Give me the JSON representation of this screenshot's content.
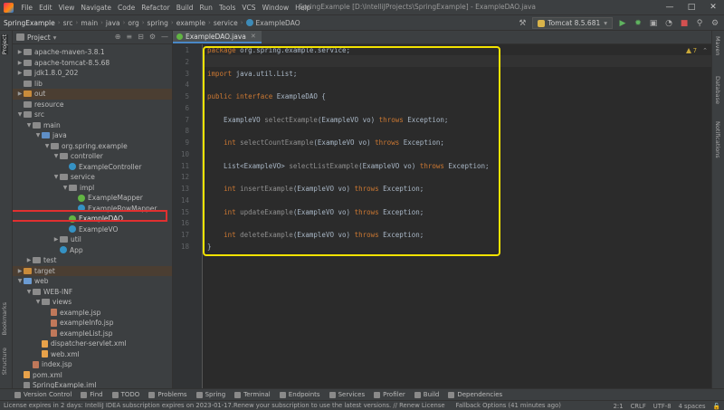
{
  "menu": {
    "items": [
      "File",
      "Edit",
      "View",
      "Navigate",
      "Code",
      "Refactor",
      "Build",
      "Run",
      "Tools",
      "VCS",
      "Window",
      "Help"
    ],
    "window_title": "SpringExample [D:\\IntelliJProjects\\SpringExample] - ExampleDAO.java"
  },
  "breadcrumb": [
    "SpringExample",
    "src",
    "main",
    "java",
    "org",
    "spring",
    "example",
    "service",
    "ExampleDAO"
  ],
  "run_config": "Tomcat 8.5.681",
  "left_tabs": {
    "project": "Project",
    "bookmarks": "Bookmarks",
    "structure": "Structure"
  },
  "right_tabs": {
    "maven": "Maven",
    "database": "Database",
    "notifications": "Notifications"
  },
  "project_panel": {
    "title": "Project",
    "tree": [
      {
        "label": "apache-maven-3.8.1",
        "indent": 1,
        "arrow": "▶",
        "icon": "folder"
      },
      {
        "label": "apache-tomcat-8.5.68",
        "indent": 1,
        "arrow": "▶",
        "icon": "folder"
      },
      {
        "label": "jdk1.8.0_202",
        "indent": 1,
        "arrow": "▶",
        "icon": "folder"
      },
      {
        "label": "lib",
        "indent": 1,
        "arrow": "",
        "icon": "folder"
      },
      {
        "label": "out",
        "indent": 1,
        "arrow": "▶",
        "icon": "orange",
        "excluded": true
      },
      {
        "label": "resource",
        "indent": 1,
        "arrow": "",
        "icon": "folder"
      },
      {
        "label": "src",
        "indent": 1,
        "arrow": "▼",
        "icon": "folder"
      },
      {
        "label": "main",
        "indent": 2,
        "arrow": "▼",
        "icon": "folder"
      },
      {
        "label": "java",
        "indent": 3,
        "arrow": "▼",
        "icon": "src"
      },
      {
        "label": "org.spring.example",
        "indent": 4,
        "arrow": "▼",
        "icon": "folder"
      },
      {
        "label": "controller",
        "indent": 5,
        "arrow": "▼",
        "icon": "folder"
      },
      {
        "label": "ExampleController",
        "indent": 6,
        "arrow": "",
        "icon": "class"
      },
      {
        "label": "service",
        "indent": 5,
        "arrow": "▼",
        "icon": "folder"
      },
      {
        "label": "impl",
        "indent": 6,
        "arrow": "▼",
        "icon": "folder"
      },
      {
        "label": "ExampleMapper",
        "indent": 7,
        "arrow": "",
        "icon": "iface"
      },
      {
        "label": "ExampleRowMapper",
        "indent": 7,
        "arrow": "",
        "icon": "class"
      },
      {
        "label": "ExampleDAO",
        "indent": 6,
        "arrow": "",
        "icon": "iface",
        "selected": true
      },
      {
        "label": "ExampleVO",
        "indent": 6,
        "arrow": "",
        "icon": "class"
      },
      {
        "label": "util",
        "indent": 5,
        "arrow": "▶",
        "icon": "folder"
      },
      {
        "label": "App",
        "indent": 5,
        "arrow": "",
        "icon": "class"
      },
      {
        "label": "test",
        "indent": 2,
        "arrow": "▶",
        "icon": "folder"
      },
      {
        "label": "target",
        "indent": 1,
        "arrow": "▶",
        "icon": "orange",
        "excluded": true
      },
      {
        "label": "web",
        "indent": 1,
        "arrow": "▼",
        "icon": "blue"
      },
      {
        "label": "WEB-INF",
        "indent": 2,
        "arrow": "▼",
        "icon": "folder"
      },
      {
        "label": "views",
        "indent": 3,
        "arrow": "▼",
        "icon": "folder"
      },
      {
        "label": "example.jsp",
        "indent": 4,
        "arrow": "",
        "icon": "jsp"
      },
      {
        "label": "exampleInfo.jsp",
        "indent": 4,
        "arrow": "",
        "icon": "jsp"
      },
      {
        "label": "exampleList.jsp",
        "indent": 4,
        "arrow": "",
        "icon": "jsp"
      },
      {
        "label": "dispatcher-servlet.xml",
        "indent": 3,
        "arrow": "",
        "icon": "xml"
      },
      {
        "label": "web.xml",
        "indent": 3,
        "arrow": "",
        "icon": "xml"
      },
      {
        "label": "index.jsp",
        "indent": 2,
        "arrow": "",
        "icon": "jsp"
      },
      {
        "label": "pom.xml",
        "indent": 1,
        "arrow": "",
        "icon": "xml"
      },
      {
        "label": "SpringExample.iml",
        "indent": 1,
        "arrow": "",
        "icon": "iml"
      }
    ]
  },
  "editor": {
    "tab_label": "ExampleDAO.java",
    "inspection": "7",
    "line_numbers": [
      "1",
      "2",
      "3",
      "4",
      "5",
      "6",
      "7",
      "8",
      "9",
      "10",
      "11",
      "12",
      "13",
      "14",
      "15",
      "16",
      "17",
      "18"
    ],
    "code": [
      [
        {
          "t": "package ",
          "c": "kw"
        },
        {
          "t": "org.spring.example.service;",
          "c": ""
        }
      ],
      [],
      [
        {
          "t": "import ",
          "c": "kw"
        },
        {
          "t": "java.util.List;",
          "c": ""
        }
      ],
      [],
      [
        {
          "t": "public interface ",
          "c": "kw"
        },
        {
          "t": "ExampleDAO {",
          "c": ""
        }
      ],
      [],
      [
        {
          "t": "    ExampleVO ",
          "c": ""
        },
        {
          "t": "selectExample",
          "c": "gr"
        },
        {
          "t": "(ExampleVO vo) ",
          "c": ""
        },
        {
          "t": "throws ",
          "c": "kw"
        },
        {
          "t": "Exception;",
          "c": ""
        }
      ],
      [],
      [
        {
          "t": "    ",
          "c": ""
        },
        {
          "t": "int ",
          "c": "kw"
        },
        {
          "t": "selectCountExample",
          "c": "gr"
        },
        {
          "t": "(ExampleVO vo) ",
          "c": ""
        },
        {
          "t": "throws ",
          "c": "kw"
        },
        {
          "t": "Exception;",
          "c": ""
        }
      ],
      [],
      [
        {
          "t": "    List<ExampleVO> ",
          "c": ""
        },
        {
          "t": "selectListExample",
          "c": "gr"
        },
        {
          "t": "(ExampleVO vo) ",
          "c": ""
        },
        {
          "t": "throws ",
          "c": "kw"
        },
        {
          "t": "Exception;",
          "c": ""
        }
      ],
      [],
      [
        {
          "t": "    ",
          "c": ""
        },
        {
          "t": "int ",
          "c": "kw"
        },
        {
          "t": "insertExample",
          "c": "gr"
        },
        {
          "t": "(ExampleVO vo) ",
          "c": ""
        },
        {
          "t": "throws ",
          "c": "kw"
        },
        {
          "t": "Exception;",
          "c": ""
        }
      ],
      [],
      [
        {
          "t": "    ",
          "c": ""
        },
        {
          "t": "int ",
          "c": "kw"
        },
        {
          "t": "updateExample",
          "c": "gr"
        },
        {
          "t": "(ExampleVO vo) ",
          "c": ""
        },
        {
          "t": "throws ",
          "c": "kw"
        },
        {
          "t": "Exception;",
          "c": ""
        }
      ],
      [],
      [
        {
          "t": "    ",
          "c": ""
        },
        {
          "t": "int ",
          "c": "kw"
        },
        {
          "t": "deleteExample",
          "c": "gr"
        },
        {
          "t": "(ExampleVO vo) ",
          "c": ""
        },
        {
          "t": "throws ",
          "c": "kw"
        },
        {
          "t": "Exception;",
          "c": ""
        }
      ],
      [
        {
          "t": "}",
          "c": ""
        }
      ]
    ]
  },
  "bottom_tools": [
    "Version Control",
    "Find",
    "TODO",
    "Problems",
    "Spring",
    "Terminal",
    "Endpoints",
    "Services",
    "Profiler",
    "Build",
    "Dependencies"
  ],
  "status": {
    "message": "License expires in 2 days: IntelliJ IDEA subscription expires on 2023-01-17.Renew your subscription to use the latest versions. // Renew License",
    "fallback": "Fallback Options (41 minutes ago)",
    "position": "2:1",
    "line_sep": "CRLF",
    "encoding": "UTF-8",
    "indent": "4 spaces"
  }
}
